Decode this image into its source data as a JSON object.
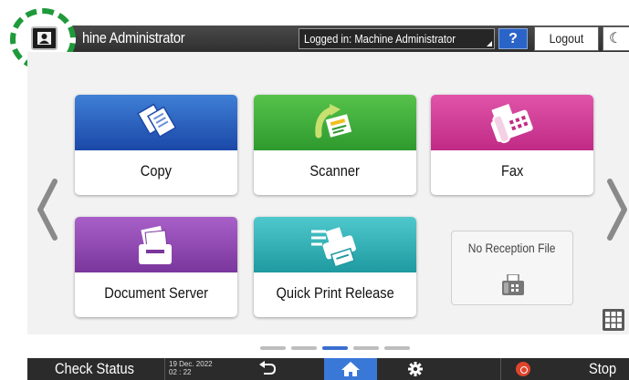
{
  "header": {
    "user_name": "hine Administrator",
    "login_status": "Logged in: Machine Administrator",
    "help_label": "?",
    "logout_label": "Logout",
    "moon_glyph": "☾"
  },
  "apps": [
    {
      "label": "Copy",
      "icon": "copy-icon",
      "color": "#2860c0"
    },
    {
      "label": "Scanner",
      "icon": "scanner-icon",
      "color": "#3aa838"
    },
    {
      "label": "Fax",
      "icon": "fax-icon",
      "color": "#cc3494"
    },
    {
      "label": "Document Server",
      "icon": "document-server-icon",
      "color": "#8c44b0"
    },
    {
      "label": "Quick Print Release",
      "icon": "quick-print-release-icon",
      "color": "#2ab0b6"
    }
  ],
  "widget": {
    "label": "No Reception File",
    "icon": "fax-reception-icon"
  },
  "pagination": {
    "total": 5,
    "current": 3
  },
  "footer": {
    "check_status": "Check Status",
    "date": "19 Dec. 2022",
    "time": "02 : 22",
    "stop_label": "Stop",
    "home_color": "#3a78d8"
  },
  "highlight_color": "#1e9a3a"
}
